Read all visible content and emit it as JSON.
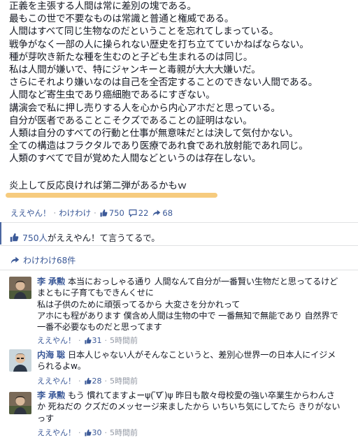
{
  "post": {
    "lines": [
      "正義を主張する人間は常に差別の塊である。",
      "最もこの世で不要なものは常識と普通と権威である。",
      "人間はすべて同じ生物なのだということを忘れてしまっている。",
      "戦争がなく一部の人に操られない歴史を打ち立てていかねばならない。",
      "種が芽吹き新たな種を生むのと子ども生まれるのは同じ。",
      "私は人間が嫌いで、特にジャンキーと毒親が大大大嫌いだ。",
      "さらにそれより嫌いなのは自己を全否定することのできない人間である。",
      "人間など寄生虫であり癌細胞であるにすぎない。",
      "講演会で私に押し売りする人を心から内心アホだと思っている。",
      "自分が医者であることこそクズであることの証明はない。",
      "人類は自分のすべての行動と仕事が無意味だとは決して気付かない。",
      "全ての構造はフラクタルであり医療であれ食であれ放射能であれ同じ。",
      "人類のすべてで目が覚めた人間などというのは存在しない。"
    ],
    "highlight": "炎上して反応良ければ第二弾があるかもｗ"
  },
  "actions": {
    "like": "ええやん！",
    "comment": "わけわけ",
    "likes_count": "750",
    "comments_count": "22",
    "shares_count": "68"
  },
  "summary": {
    "likes_number": "750人",
    "likes_suffix": "がええやん！て言うてるで。",
    "shares": "わけわけ68件"
  },
  "comments": [
    {
      "author": "李 承勲",
      "lines": [
        "本当におっしゃる通り 人間なんて自分が一番賢い生物だと思ってるけど",
        "まともに子育てもできんくせに",
        "私は子供のために頑張ってるから 大変さを分かれって",
        "アホにも程があります 僕含め人間は生物の中で 一番無知で無能であり 自然界で",
        "一番不必要なものだと思ってます"
      ],
      "like_label": "ええやん！",
      "likes": "31",
      "time": "5時間前"
    },
    {
      "author": "内海 聡",
      "lines": [
        "日本人じゃない人がそんなこというと、差別心世界一の日本人にイジメ",
        "られるよw。"
      ],
      "like_label": "ええやん！",
      "likes": "28",
      "time": "5時間前"
    },
    {
      "author": "李 承勲",
      "lines": [
        "もう 慣れてますよーψ( ̄∇ ̄)ψ 昨日も散々母校愛の強い卒業生からわんさ",
        "か 死ねだの クズだのメッセージ来ましたから いちいち気にしてたら きりがない",
        "っす"
      ],
      "like_label": "ええやん！",
      "likes": "30",
      "time": "5時間前"
    }
  ],
  "colors": {
    "link": "#3b5998",
    "meta": "#9197a3",
    "highlight": "#f5c267",
    "divider": "#e1e2e3"
  },
  "icons": [
    "thumbs-up-icon",
    "speech-bubble-icon",
    "share-arrow-icon"
  ]
}
